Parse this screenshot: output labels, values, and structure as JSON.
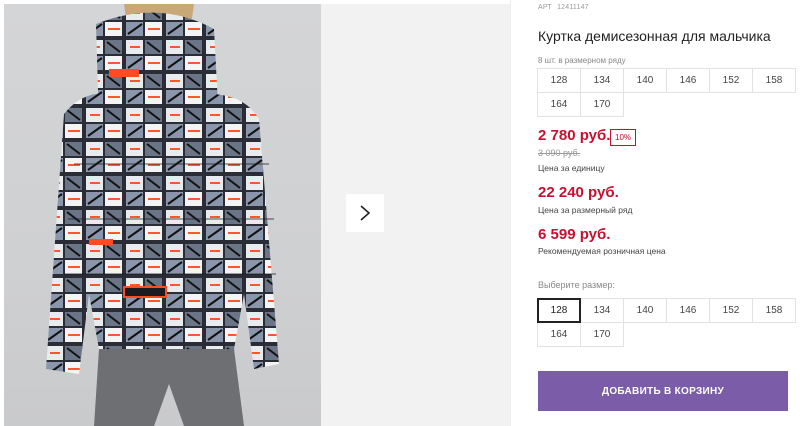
{
  "product": {
    "art_label": "АРТ",
    "art_number": "12411147",
    "title": "Куртка демисезонная для мальчика"
  },
  "gallery": {
    "image_alt": "boy-jacket-back-view",
    "next_icon": "chevron-right-icon"
  },
  "pack": {
    "label": "8 шт. в размерном ряду",
    "sizes": [
      "128",
      "134",
      "140",
      "146",
      "152",
      "158",
      "164",
      "170"
    ]
  },
  "prices": {
    "unit_price": "2 780 руб.",
    "discount": "10%",
    "old_price": "3 090 руб.",
    "unit_label": "Цена за единицу",
    "pack_price": "22 240 руб.",
    "pack_label": "Цена за размерный ряд",
    "rrp_price": "6 599 руб.",
    "rrp_label": "Рекомендуемая розничная цена"
  },
  "size_select": {
    "label": "Выберите размер:",
    "sizes": [
      "128",
      "134",
      "140",
      "146",
      "152",
      "158",
      "164",
      "170"
    ],
    "selected": "128"
  },
  "cart": {
    "add_label": "ДОБАВИТЬ В КОРЗИНУ"
  },
  "colors": {
    "price_red": "#c8102e",
    "button_purple": "#7a5ca8"
  }
}
